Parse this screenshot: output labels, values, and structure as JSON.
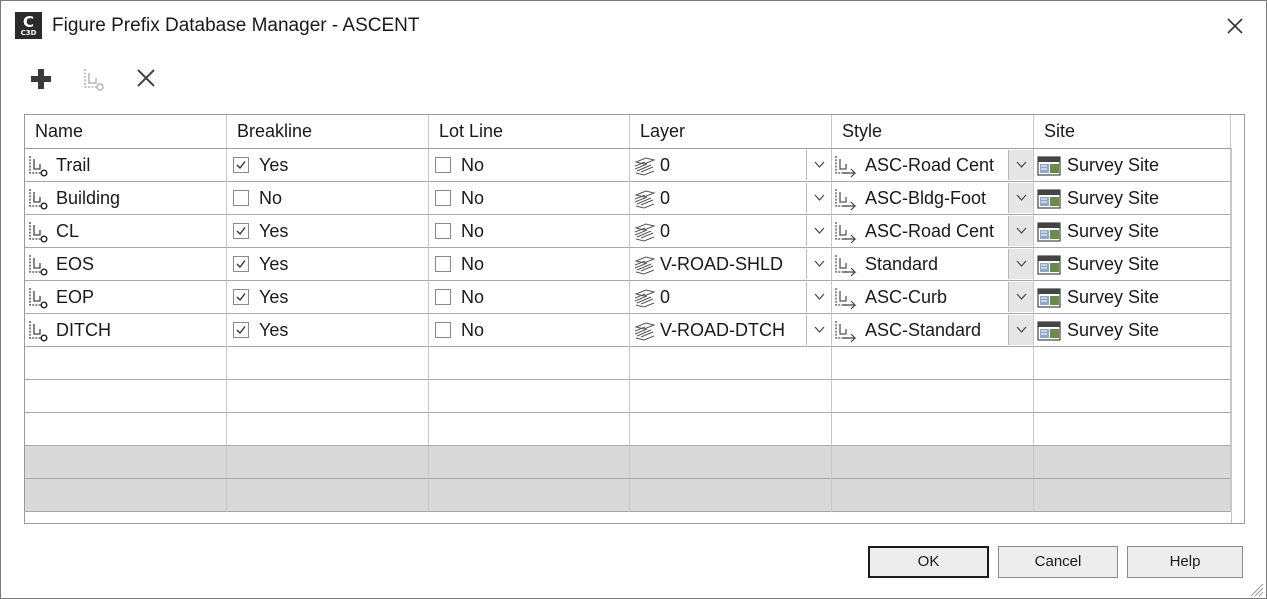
{
  "window": {
    "app_icon_letter": "C",
    "app_icon_sub": "C3D",
    "title": "Figure Prefix Database Manager - ASCENT"
  },
  "toolbar": {
    "buttons": [
      "add-icon",
      "figure-prefix-icon",
      "delete-icon"
    ]
  },
  "grid": {
    "columns": [
      "Name",
      "Breakline",
      "Lot Line",
      "Layer",
      "Style",
      "Site"
    ],
    "rows": [
      {
        "name": "Trail",
        "breakline": true,
        "breakline_text": "Yes",
        "lotline": false,
        "lotline_text": "No",
        "layer": "0",
        "style": "ASC-Road Cent",
        "site": "Survey Site"
      },
      {
        "name": "Building",
        "breakline": false,
        "breakline_text": "No",
        "lotline": false,
        "lotline_text": "No",
        "layer": "0",
        "style": "ASC-Bldg-Foot",
        "site": "Survey Site"
      },
      {
        "name": "CL",
        "breakline": true,
        "breakline_text": "Yes",
        "lotline": false,
        "lotline_text": "No",
        "layer": "0",
        "style": "ASC-Road Cent",
        "site": "Survey Site"
      },
      {
        "name": "EOS",
        "breakline": true,
        "breakline_text": "Yes",
        "lotline": false,
        "lotline_text": "No",
        "layer": "V-ROAD-SHLD",
        "style": "Standard",
        "site": "Survey Site"
      },
      {
        "name": "EOP",
        "breakline": true,
        "breakline_text": "Yes",
        "lotline": false,
        "lotline_text": "No",
        "layer": "0",
        "style": "ASC-Curb",
        "site": "Survey Site"
      },
      {
        "name": "DITCH",
        "breakline": true,
        "breakline_text": "Yes",
        "lotline": false,
        "lotline_text": "No",
        "layer": "V-ROAD-DTCH",
        "style": "ASC-Standard",
        "site": "Survey Site"
      }
    ]
  },
  "buttons": {
    "ok": "OK",
    "cancel": "Cancel",
    "help": "Help"
  }
}
